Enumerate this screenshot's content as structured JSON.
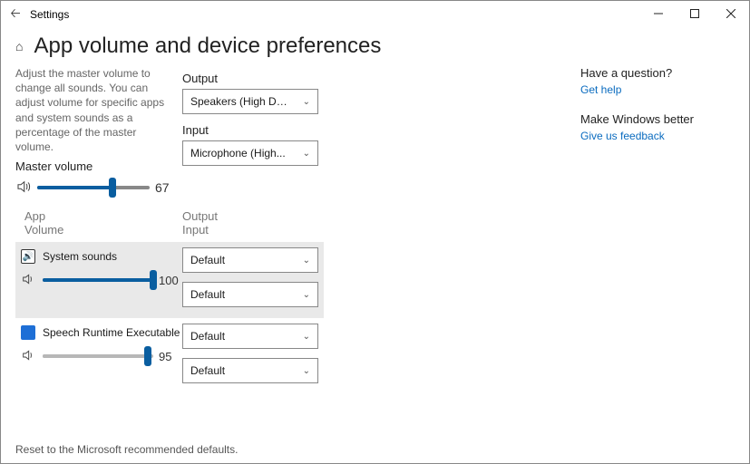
{
  "window": {
    "title": "Settings"
  },
  "page": {
    "heading": "App volume and device preferences",
    "description": "Adjust the master volume to change all sounds. You can adjust volume for specific apps and system sounds as a percentage of the master volume.",
    "master_label": "Master volume",
    "master_value": "67",
    "output_label": "Output",
    "output_selected": "Speakers (High Defi...",
    "input_label": "Input",
    "input_selected": "Microphone (High...",
    "col_app": "App",
    "col_volume": "Volume",
    "col_output": "Output",
    "col_input": "Input",
    "reset": "Reset to the Microsoft recommended defaults."
  },
  "apps": [
    {
      "name": "System sounds",
      "volume": "100",
      "out": "Default",
      "in": "Default"
    },
    {
      "name": "Speech Runtime Executable",
      "volume": "95",
      "out": "Default",
      "in": "Default"
    }
  ],
  "sidebar": {
    "q": "Have a question?",
    "help": "Get help",
    "better": "Make Windows better",
    "feedback": "Give us feedback"
  }
}
